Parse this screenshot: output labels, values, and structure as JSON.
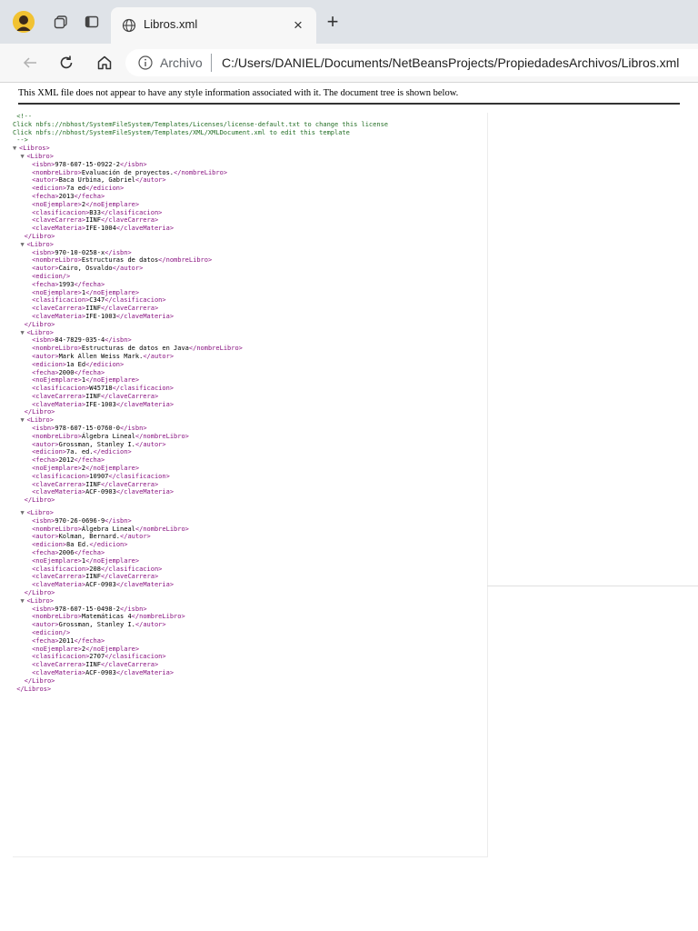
{
  "browser": {
    "tab_title": "Libros.xml",
    "close_glyph": "×",
    "new_tab_glyph": "+",
    "address": {
      "site_label": "Archivo",
      "url": "C:/Users/DANIEL/Documents/NetBeansProjects/PropiedadesArchivos/Libros.xml"
    },
    "icons": {
      "profile": "profile-avatar-icon",
      "workspaces": "workspaces-icon",
      "tab_actions": "tab-actions-icon",
      "tab_favicon": "globe-icon",
      "back": "back-arrow-icon",
      "reload": "reload-icon",
      "home": "home-icon",
      "site_info": "info-icon"
    }
  },
  "xml_viewer": {
    "info_message": "This XML file does not appear to have any style information associated with it. The document tree is shown below.",
    "comment": {
      "open": "<!--",
      "lines": [
        "Click nbfs://nbhost/SystemFileSystem/Templates/Licenses/license-default.txt to change this license",
        "Click nbfs://nbhost/SystemFileSystem/Templates/XML/XMLDocument.xml to edit this template"
      ],
      "close": "-->"
    },
    "fold_glyph": "▼",
    "root": "Libros",
    "record": "Libro",
    "books": [
      [
        [
          "isbn",
          "978-607-15-0922-2"
        ],
        [
          "nombreLibro",
          "Evaluación de proyectos."
        ],
        [
          "autor",
          "Baca Urbina, Gabriel"
        ],
        [
          "edicion",
          "7a ed"
        ],
        [
          "fecha",
          "2013"
        ],
        [
          "noEjemplare",
          "2"
        ],
        [
          "clasificacion",
          "B33"
        ],
        [
          "claveCarrera",
          "IINF"
        ],
        [
          "claveMateria",
          "IFE-1004"
        ]
      ],
      [
        [
          "isbn",
          "970-10-0258-x"
        ],
        [
          "nombreLibro",
          "Estructuras de datos"
        ],
        [
          "autor",
          "Cairo, Osvaldo"
        ],
        [
          "edicion",
          null
        ],
        [
          "fecha",
          "1993"
        ],
        [
          "noEjemplare",
          "1"
        ],
        [
          "clasificacion",
          "C347"
        ],
        [
          "claveCarrera",
          "IINF"
        ],
        [
          "claveMateria",
          "IFE-1003"
        ]
      ],
      [
        [
          "isbn",
          "84-7829-035-4"
        ],
        [
          "nombreLibro",
          "Estructuras de datos en Java"
        ],
        [
          "autor",
          "Mark Allen Weiss Mark."
        ],
        [
          "edicion",
          "1a Ed"
        ],
        [
          "fecha",
          "2000"
        ],
        [
          "noEjemplare",
          "1"
        ],
        [
          "clasificacion",
          "W45718"
        ],
        [
          "claveCarrera",
          "IINF"
        ],
        [
          "claveMateria",
          "IFE-1003"
        ]
      ],
      [
        [
          "isbn",
          "978-607-15-0760-0"
        ],
        [
          "nombreLibro",
          "Álgebra Lineal"
        ],
        [
          "autor",
          "Grossman, Stanley I."
        ],
        [
          "edicion",
          "7a. ed."
        ],
        [
          "fecha",
          "2012"
        ],
        [
          "noEjemplare",
          "2"
        ],
        [
          "clasificacion",
          "10907"
        ],
        [
          "claveCarrera",
          "IINF"
        ],
        [
          "claveMateria",
          "ACF-0903"
        ]
      ],
      [
        [
          "isbn",
          "970-26-0696-9"
        ],
        [
          "nombreLibro",
          "Álgebra Lineal"
        ],
        [
          "autor",
          "Kolman, Bernard."
        ],
        [
          "edicion",
          "8a Ed."
        ],
        [
          "fecha",
          "2006"
        ],
        [
          "noEjemplare",
          "1"
        ],
        [
          "clasificacion",
          "208"
        ],
        [
          "claveCarrera",
          "IINF"
        ],
        [
          "claveMateria",
          "ACF-0903"
        ]
      ],
      [
        [
          "isbn",
          "978-607-15-0498-2"
        ],
        [
          "nombreLibro",
          "Matemáticas 4"
        ],
        [
          "autor",
          "Grossman, Stanley I."
        ],
        [
          "edicion",
          null
        ],
        [
          "fecha",
          "2011"
        ],
        [
          "noEjemplare",
          "2"
        ],
        [
          "clasificacion",
          "2707"
        ],
        [
          "claveCarrera",
          "IINF"
        ],
        [
          "claveMateria",
          "ACF-0903"
        ]
      ]
    ]
  }
}
